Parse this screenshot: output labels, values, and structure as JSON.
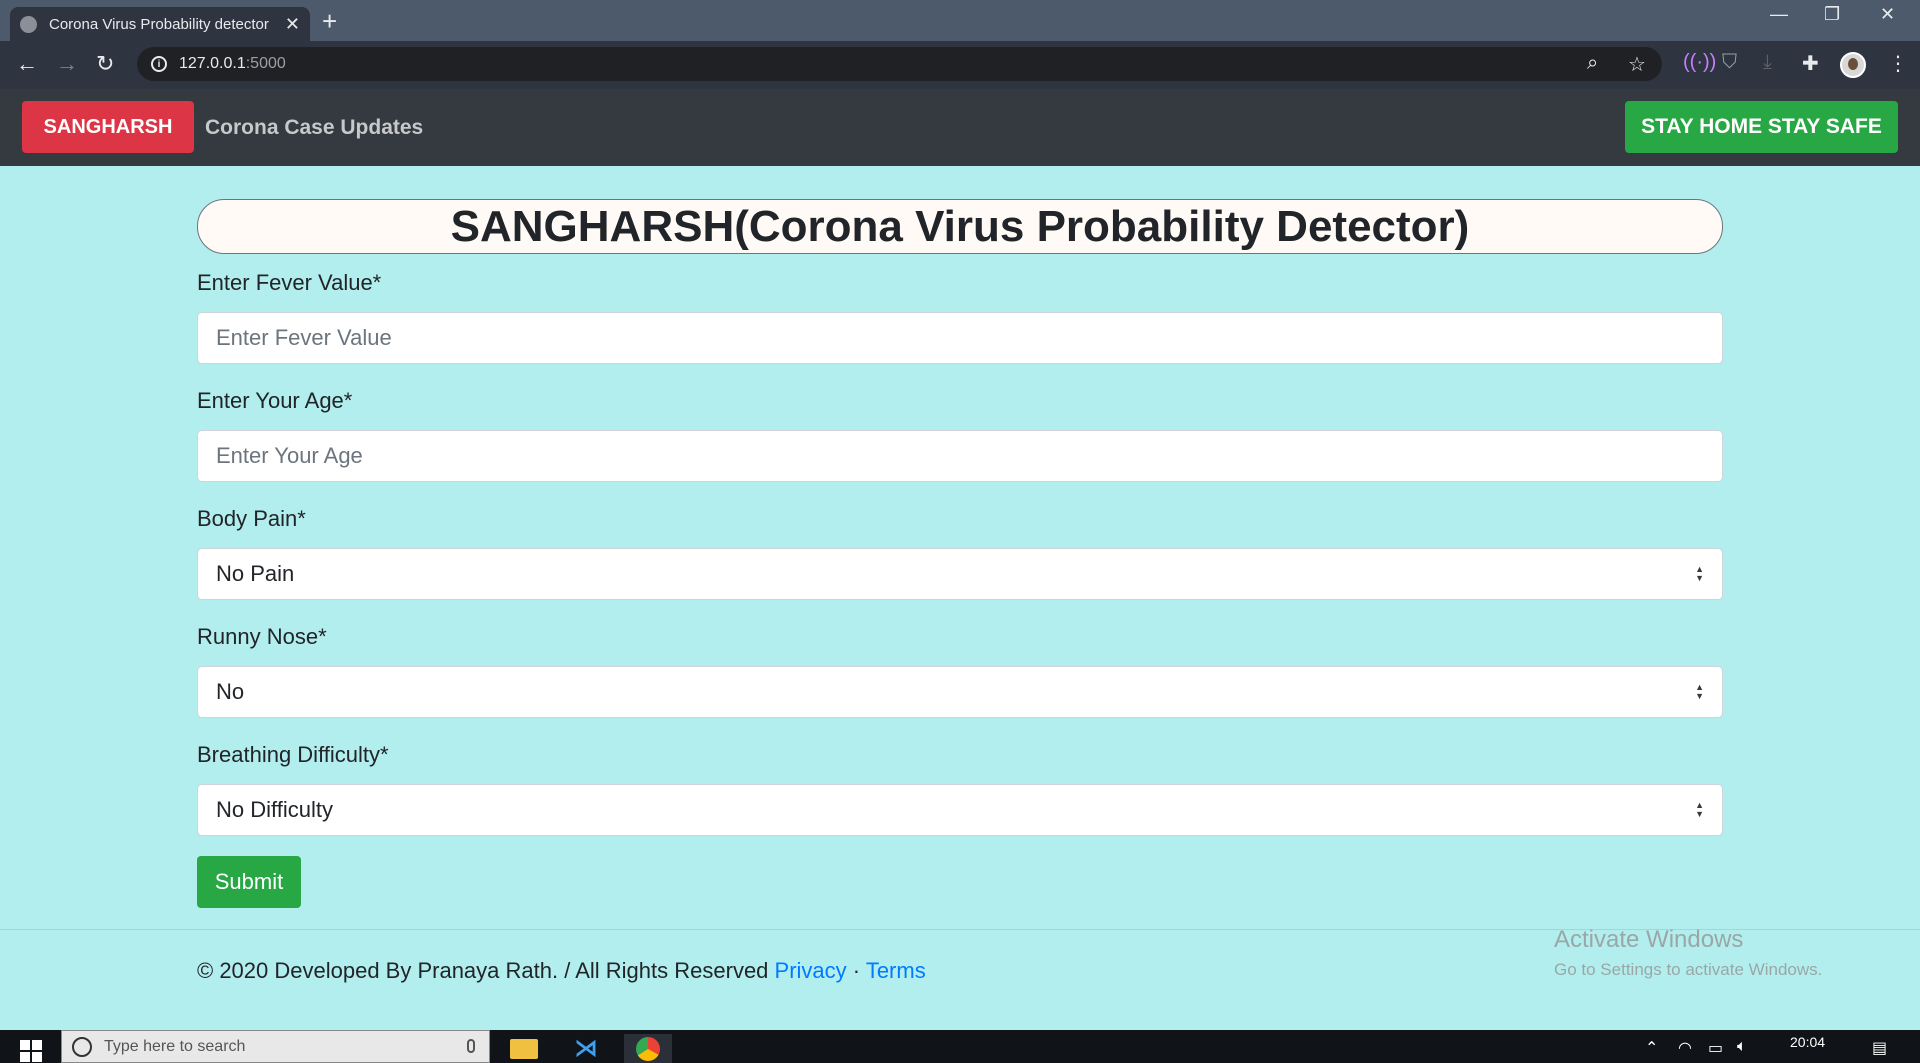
{
  "browser": {
    "tab_title": "Corona Virus Probability detector",
    "url_host": "127.0.0.1",
    "url_port": ":5000"
  },
  "navbar": {
    "brand": "SANGHARSH",
    "link": "Corona Case Updates",
    "cta": "STAY HOME STAY SAFE"
  },
  "form": {
    "title": "SANGHARSH(Corona Virus Probability Detector)",
    "fever": {
      "label": "Enter Fever Value*",
      "placeholder": "Enter Fever Value"
    },
    "age": {
      "label": "Enter Your Age*",
      "placeholder": "Enter Your Age"
    },
    "body_pain": {
      "label": "Body Pain*",
      "selected": "No Pain"
    },
    "runny_nose": {
      "label": "Runny Nose*",
      "selected": "No"
    },
    "breathing": {
      "label": "Breathing Difficulty*",
      "selected": "No Difficulty"
    },
    "submit": "Submit"
  },
  "footer": {
    "text": "© 2020 Developed By Pranaya Rath. / All Rights Reserved ",
    "privacy": "Privacy",
    "separator": " · ",
    "terms": "Terms"
  },
  "watermark": {
    "line1": "Activate Windows",
    "line2": "Go to Settings to activate Windows."
  },
  "taskbar": {
    "search_placeholder": "Type here to search",
    "time": "20:04"
  },
  "colors": {
    "page_bg": "#b3eeee",
    "navbar_bg": "#343a40",
    "brand_red": "#dc3545",
    "success_green": "#28a745",
    "link_blue": "#007bff"
  }
}
